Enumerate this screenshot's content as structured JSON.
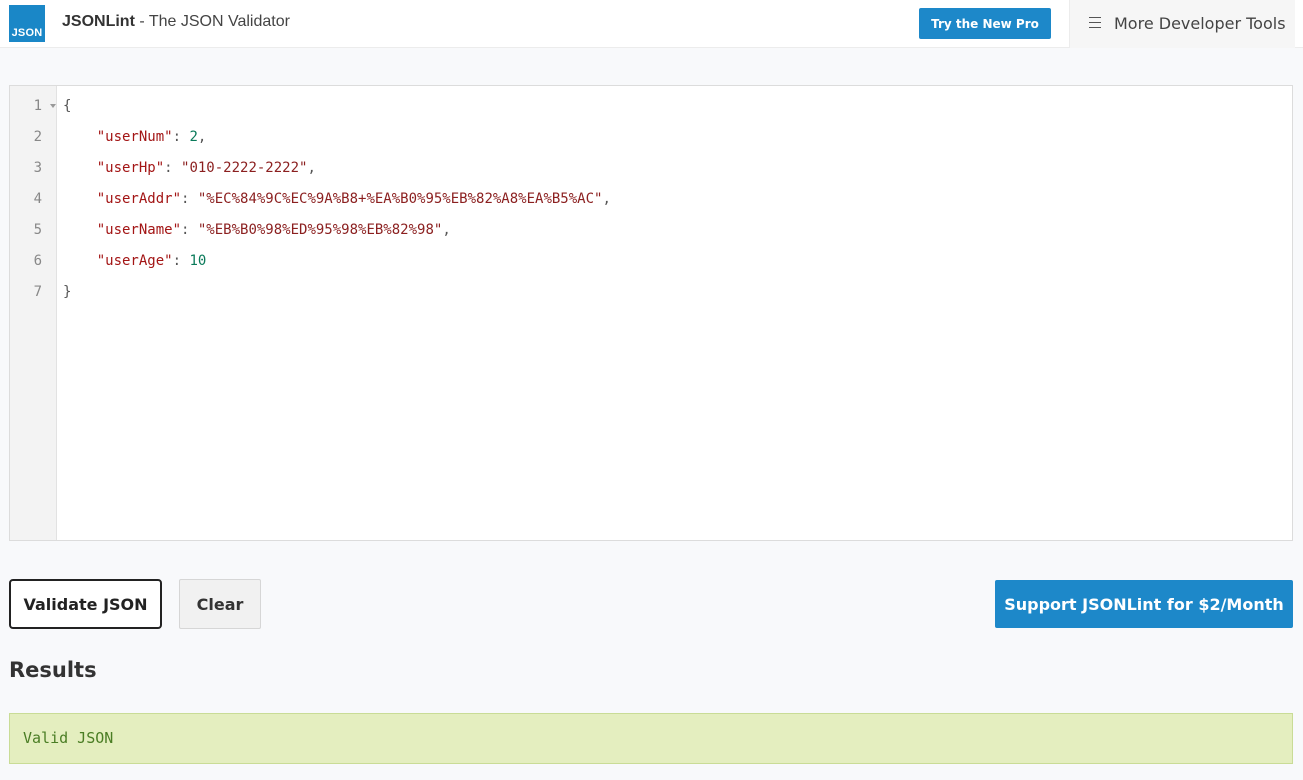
{
  "header": {
    "logo_text": "JSON",
    "brand": "JSONLint",
    "subtitle": " - The JSON Validator",
    "pro_button": "Try the New Pro",
    "tools_label": "More Developer Tools",
    "tools_icon": "menu-icon"
  },
  "editor": {
    "line_numbers": [
      "1",
      "2",
      "3",
      "4",
      "5",
      "6",
      "7"
    ],
    "lines": [
      [
        [
          "p",
          "{"
        ]
      ],
      [
        [
          "p",
          "    "
        ],
        [
          "k",
          "\"userNum\""
        ],
        [
          "p",
          ": "
        ],
        [
          "n",
          "2"
        ],
        [
          "p",
          ","
        ]
      ],
      [
        [
          "p",
          "    "
        ],
        [
          "k",
          "\"userHp\""
        ],
        [
          "p",
          ": "
        ],
        [
          "s",
          "\"010-2222-2222\""
        ],
        [
          "p",
          ","
        ]
      ],
      [
        [
          "p",
          "    "
        ],
        [
          "k",
          "\"userAddr\""
        ],
        [
          "p",
          ": "
        ],
        [
          "s",
          "\"%EC%84%9C%EC%9A%B8+%EA%B0%95%EB%82%A8%EA%B5%AC\""
        ],
        [
          "p",
          ","
        ]
      ],
      [
        [
          "p",
          "    "
        ],
        [
          "k",
          "\"userName\""
        ],
        [
          "p",
          ": "
        ],
        [
          "s",
          "\"%EB%B0%98%ED%95%98%EB%82%98\""
        ],
        [
          "p",
          ","
        ]
      ],
      [
        [
          "p",
          "    "
        ],
        [
          "k",
          "\"userAge\""
        ],
        [
          "p",
          ": "
        ],
        [
          "n",
          "10"
        ]
      ],
      [
        [
          "p",
          "}"
        ]
      ]
    ]
  },
  "actions": {
    "validate": "Validate JSON",
    "clear": "Clear",
    "support": "Support JSONLint for $2/Month"
  },
  "results": {
    "title": "Results",
    "message": "Valid JSON"
  },
  "colors": {
    "accent": "#1d88c9",
    "success_bg": "#e4eebf",
    "success_text": "#4a7d24"
  }
}
